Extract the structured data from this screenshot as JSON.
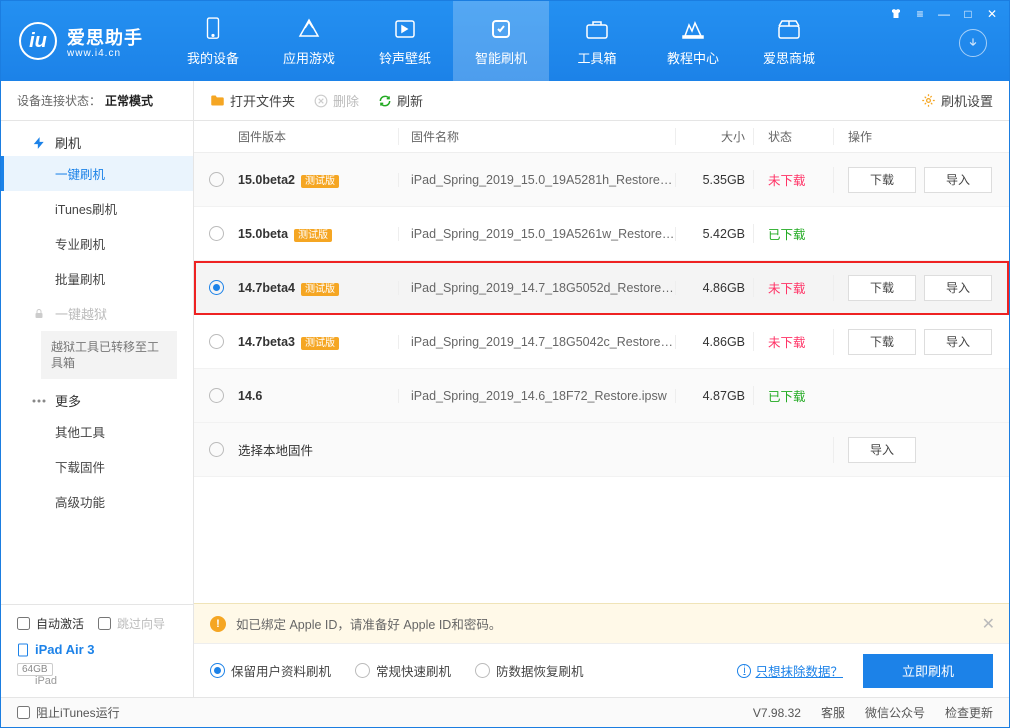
{
  "brand": {
    "title": "爱思助手",
    "url": "www.i4.cn"
  },
  "nav": [
    {
      "label": "我的设备"
    },
    {
      "label": "应用游戏"
    },
    {
      "label": "铃声壁纸"
    },
    {
      "label": "智能刷机"
    },
    {
      "label": "工具箱"
    },
    {
      "label": "教程中心"
    },
    {
      "label": "爱思商城"
    }
  ],
  "sidebar": {
    "conn_label": "设备连接状态：",
    "conn_value": "正常模式",
    "group_flash": "刷机",
    "items_flash": [
      "一键刷机",
      "iTunes刷机",
      "专业刷机",
      "批量刷机"
    ],
    "group_jailbreak": "一键越狱",
    "jailbreak_note": "越狱工具已转移至工具箱",
    "group_more": "更多",
    "items_more": [
      "其他工具",
      "下载固件",
      "高级功能"
    ],
    "auto_activate": "自动激活",
    "skip_guide": "跳过向导",
    "device_name": "iPad Air 3",
    "device_storage": "64GB",
    "device_type": "iPad"
  },
  "toolbar": {
    "open": "打开文件夹",
    "delete": "删除",
    "refresh": "刷新",
    "settings": "刷机设置"
  },
  "columns": {
    "version": "固件版本",
    "name": "固件名称",
    "size": "大小",
    "status": "状态",
    "ops": "操作"
  },
  "status_labels": {
    "not_downloaded": "未下载",
    "downloaded": "已下载"
  },
  "op_labels": {
    "download": "下载",
    "import": "导入"
  },
  "beta_tag": "测试版",
  "rows": [
    {
      "version": "15.0beta2",
      "beta": true,
      "name": "iPad_Spring_2019_15.0_19A5281h_Restore.ip...",
      "size": "5.35GB",
      "status": "not_downloaded",
      "download": true,
      "import": true
    },
    {
      "version": "15.0beta",
      "beta": true,
      "name": "iPad_Spring_2019_15.0_19A5261w_Restore.i...",
      "size": "5.42GB",
      "status": "downloaded",
      "download": false,
      "import": false
    },
    {
      "version": "14.7beta4",
      "beta": true,
      "name": "iPad_Spring_2019_14.7_18G5052d_Restore.i...",
      "size": "4.86GB",
      "status": "not_downloaded",
      "download": true,
      "import": true,
      "selected": true
    },
    {
      "version": "14.7beta3",
      "beta": true,
      "name": "iPad_Spring_2019_14.7_18G5042c_Restore.ip...",
      "size": "4.86GB",
      "status": "not_downloaded",
      "download": true,
      "import": true
    },
    {
      "version": "14.6",
      "beta": false,
      "name": "iPad_Spring_2019_14.6_18F72_Restore.ipsw",
      "size": "4.87GB",
      "status": "downloaded",
      "download": false,
      "import": false
    }
  ],
  "local_row": "选择本地固件",
  "alert": "如已绑定 Apple ID，请准备好 Apple ID和密码。",
  "flash_options": [
    "保留用户资料刷机",
    "常规快速刷机",
    "防数据恢复刷机"
  ],
  "erase_link": "只想抹除数据？",
  "flash_button": "立即刷机",
  "footer": {
    "block_itunes": "阻止iTunes运行",
    "version": "V7.98.32",
    "links": [
      "客服",
      "微信公众号",
      "检查更新"
    ]
  }
}
